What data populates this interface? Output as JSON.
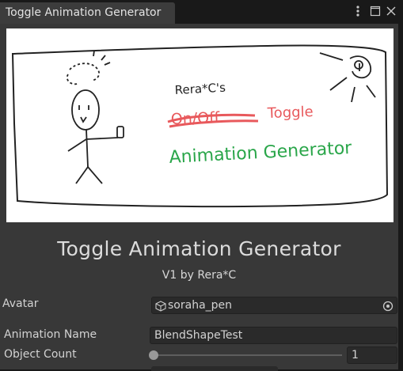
{
  "window": {
    "tab_title": "Toggle Animation Generator",
    "controls": {
      "menu_icon": "more-vertical-icon",
      "maximize_icon": "maximize-icon",
      "close_icon": "close-icon"
    }
  },
  "banner": {
    "line_author": "Rera*C's",
    "line_onoff": "On/Off",
    "line_toggle": "Toggle",
    "line_generator": "Animation Generator",
    "colors": {
      "ink": "#222222",
      "red": "#e8595c",
      "green": "#2aa64a"
    }
  },
  "header": {
    "title": "Toggle Animation Generator",
    "version": "V1 by Rera*C"
  },
  "fields": {
    "avatar_label": "Avatar",
    "avatar_value": "soraha_pen",
    "animation_name_label": "Animation Name",
    "animation_name_value": "BlendShapeTest",
    "object_count_label": "Object Count",
    "object_count_value": "1",
    "object_count_slider_fraction": 0.0
  },
  "colors": {
    "panel_bg": "#383838",
    "field_bg": "#2a2a2a",
    "text": "#d2d2d2"
  }
}
